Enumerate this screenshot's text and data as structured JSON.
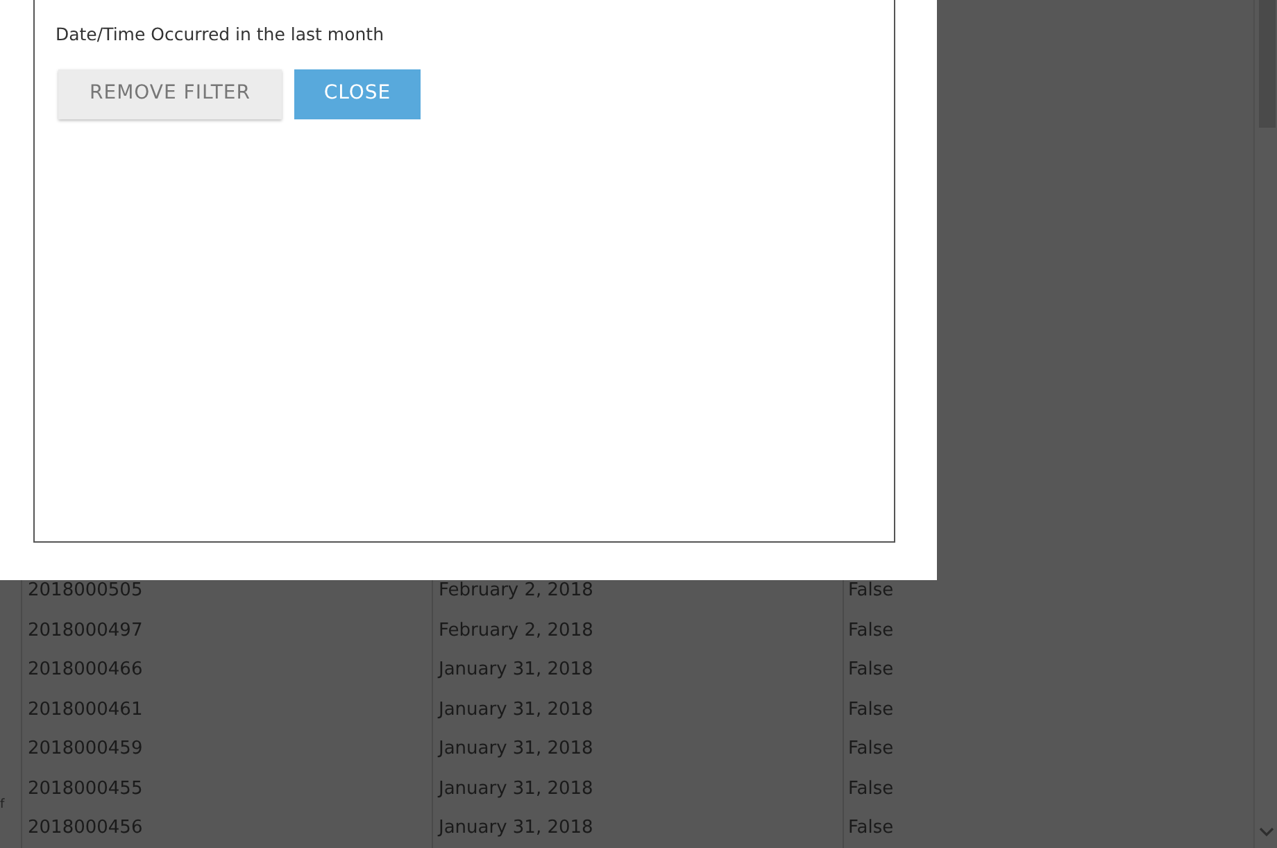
{
  "dialog": {
    "filter_text": "Date/Time Occurred in the last month",
    "buttons": [
      {
        "label": "REMOVE FILTER",
        "kind": "secondary"
      },
      {
        "label": "CLOSE",
        "kind": "primary"
      }
    ]
  },
  "left_edge_text": "f",
  "table": {
    "rows": [
      {
        "column_1": "2018000505",
        "column_2": "February 2, 2018",
        "column_3": "False"
      },
      {
        "column_1": "2018000497",
        "column_2": "February 2, 2018",
        "column_3": "False"
      },
      {
        "column_1": "2018000466",
        "column_2": "January 31, 2018",
        "column_3": "False"
      },
      {
        "column_1": "2018000461",
        "column_2": "January 31, 2018",
        "column_3": "False"
      },
      {
        "column_1": "2018000459",
        "column_2": "January 31, 2018",
        "column_3": "False"
      },
      {
        "column_1": "2018000455",
        "column_2": "January 31, 2018",
        "column_3": "False"
      },
      {
        "column_1": "2018000456",
        "column_2": "January 31, 2018",
        "column_3": "False"
      }
    ]
  }
}
